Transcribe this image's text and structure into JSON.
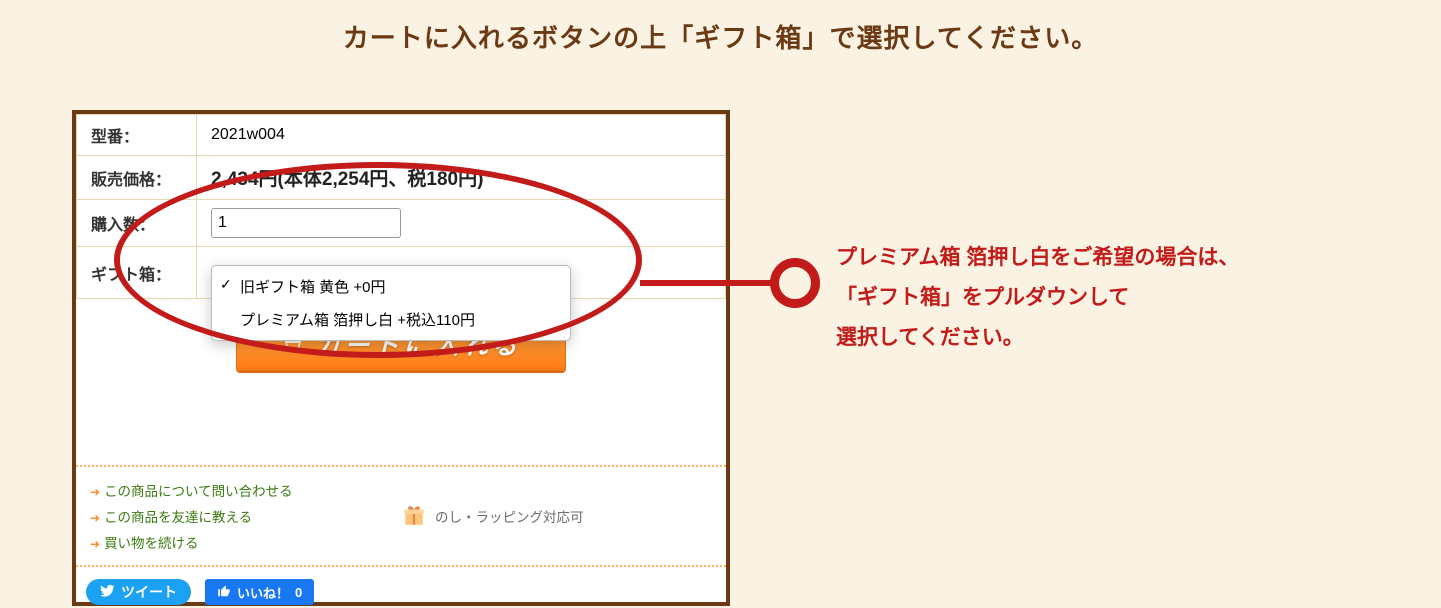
{
  "page_title": "カートに入れるボタンの上「ギフト箱」で選択してください。",
  "product": {
    "model_label": "型番：",
    "model_value": "2021w004",
    "price_label": "販売価格：",
    "price_value": "2,434円(本体2,254円、税180円)",
    "qty_label": "購入数：",
    "qty_value": "1",
    "giftbox_label": "ギフト箱："
  },
  "giftbox_options": [
    "旧ギフト箱 黄色 +0円",
    "プレミアム箱 箔押し白 +税込110円"
  ],
  "cart_button_label": "カートに入れる",
  "links": {
    "inquire": "この商品について問い合わせる",
    "tell_friend": "この商品を友達に教える",
    "continue_shopping": "買い物を続ける"
  },
  "wrapping_label": "のし・ラッピング対応可",
  "social": {
    "tweet": "ツイート",
    "like": "いいね！",
    "like_count": "0"
  },
  "annotation": {
    "line1": "プレミアム箱 箔押し白をご希望の場合は、",
    "line2": "「ギフト箱」をプルダウンして",
    "line3": "選択してください。"
  }
}
